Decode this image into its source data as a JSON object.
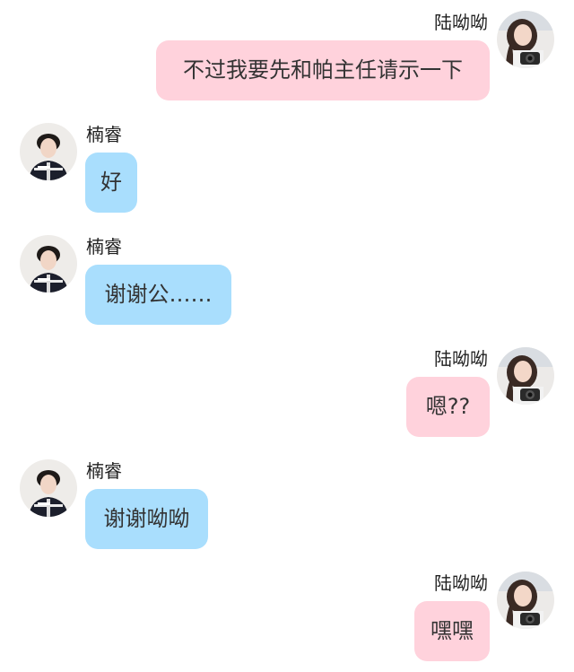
{
  "participants": {
    "self": {
      "name": "陆呦呦",
      "bubble_color": "#ffd2dc"
    },
    "other": {
      "name": "楠睿",
      "bubble_color": "#a9defd"
    }
  },
  "messages": [
    {
      "sender": "self",
      "name": "陆呦呦",
      "text": "不过我要先和帕主任请示一下"
    },
    {
      "sender": "other",
      "name": "楠睿",
      "text": "好"
    },
    {
      "sender": "other",
      "name": "楠睿",
      "text": "谢谢公……"
    },
    {
      "sender": "self",
      "name": "陆呦呦",
      "text": "嗯??"
    },
    {
      "sender": "other",
      "name": "楠睿",
      "text": "谢谢呦呦"
    },
    {
      "sender": "self",
      "name": "陆呦呦",
      "text": "嘿嘿"
    }
  ]
}
